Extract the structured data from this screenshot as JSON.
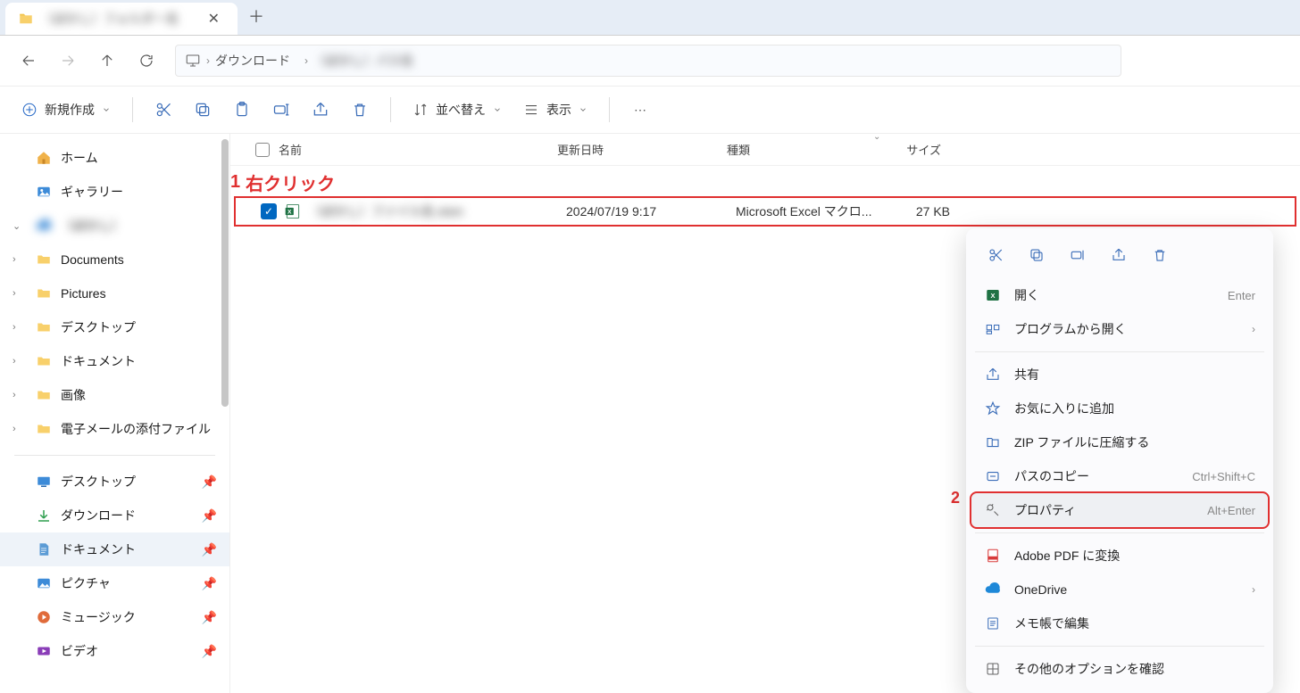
{
  "tab": {
    "title": "（ぼかし）フォルダー名",
    "close_glyph": "✕",
    "add_glyph": "＋"
  },
  "nav": {
    "crumb_downloads": "ダウンロード",
    "crumb_blur": "（ぼかし）パス名"
  },
  "toolbar": {
    "new_label": "新規作成",
    "sort_label": "並べ替え",
    "view_label": "表示"
  },
  "sidebar": {
    "home": "ホーム",
    "gallery": "ギャラリー",
    "blur_item": "（ぼかし）",
    "documents": "Documents",
    "pictures": "Pictures",
    "desktop_jp": "デスクトップ",
    "documents_jp": "ドキュメント",
    "images_jp": "画像",
    "email_attachments": "電子メールの添付ファイル",
    "quick_desktop": "デスクトップ",
    "quick_downloads": "ダウンロード",
    "quick_documents": "ドキュメント",
    "quick_pictures": "ピクチャ",
    "quick_music": "ミュージック",
    "quick_videos": "ビデオ"
  },
  "columns": {
    "name": "名前",
    "date": "更新日時",
    "type": "種類",
    "size": "サイズ"
  },
  "row": {
    "filename_blur": "（ぼかし）ファイル名.xlsm",
    "date": "2024/07/19 9:17",
    "type": "Microsoft Excel マクロ...",
    "size": "27 KB"
  },
  "annotations": {
    "a1_num": "1",
    "a1_text": "右クリック",
    "a2_num": "2"
  },
  "context_menu": {
    "open": "開く",
    "open_sc": "Enter",
    "open_with": "プログラムから開く",
    "share": "共有",
    "favorite": "お気に入りに追加",
    "zip": "ZIP ファイルに圧縮する",
    "copy_path": "パスのコピー",
    "copy_path_sc": "Ctrl+Shift+C",
    "properties": "プロパティ",
    "properties_sc": "Alt+Enter",
    "adobe": "Adobe PDF に変換",
    "onedrive": "OneDrive",
    "notepad": "メモ帳で編集",
    "more": "その他のオプションを確認"
  }
}
